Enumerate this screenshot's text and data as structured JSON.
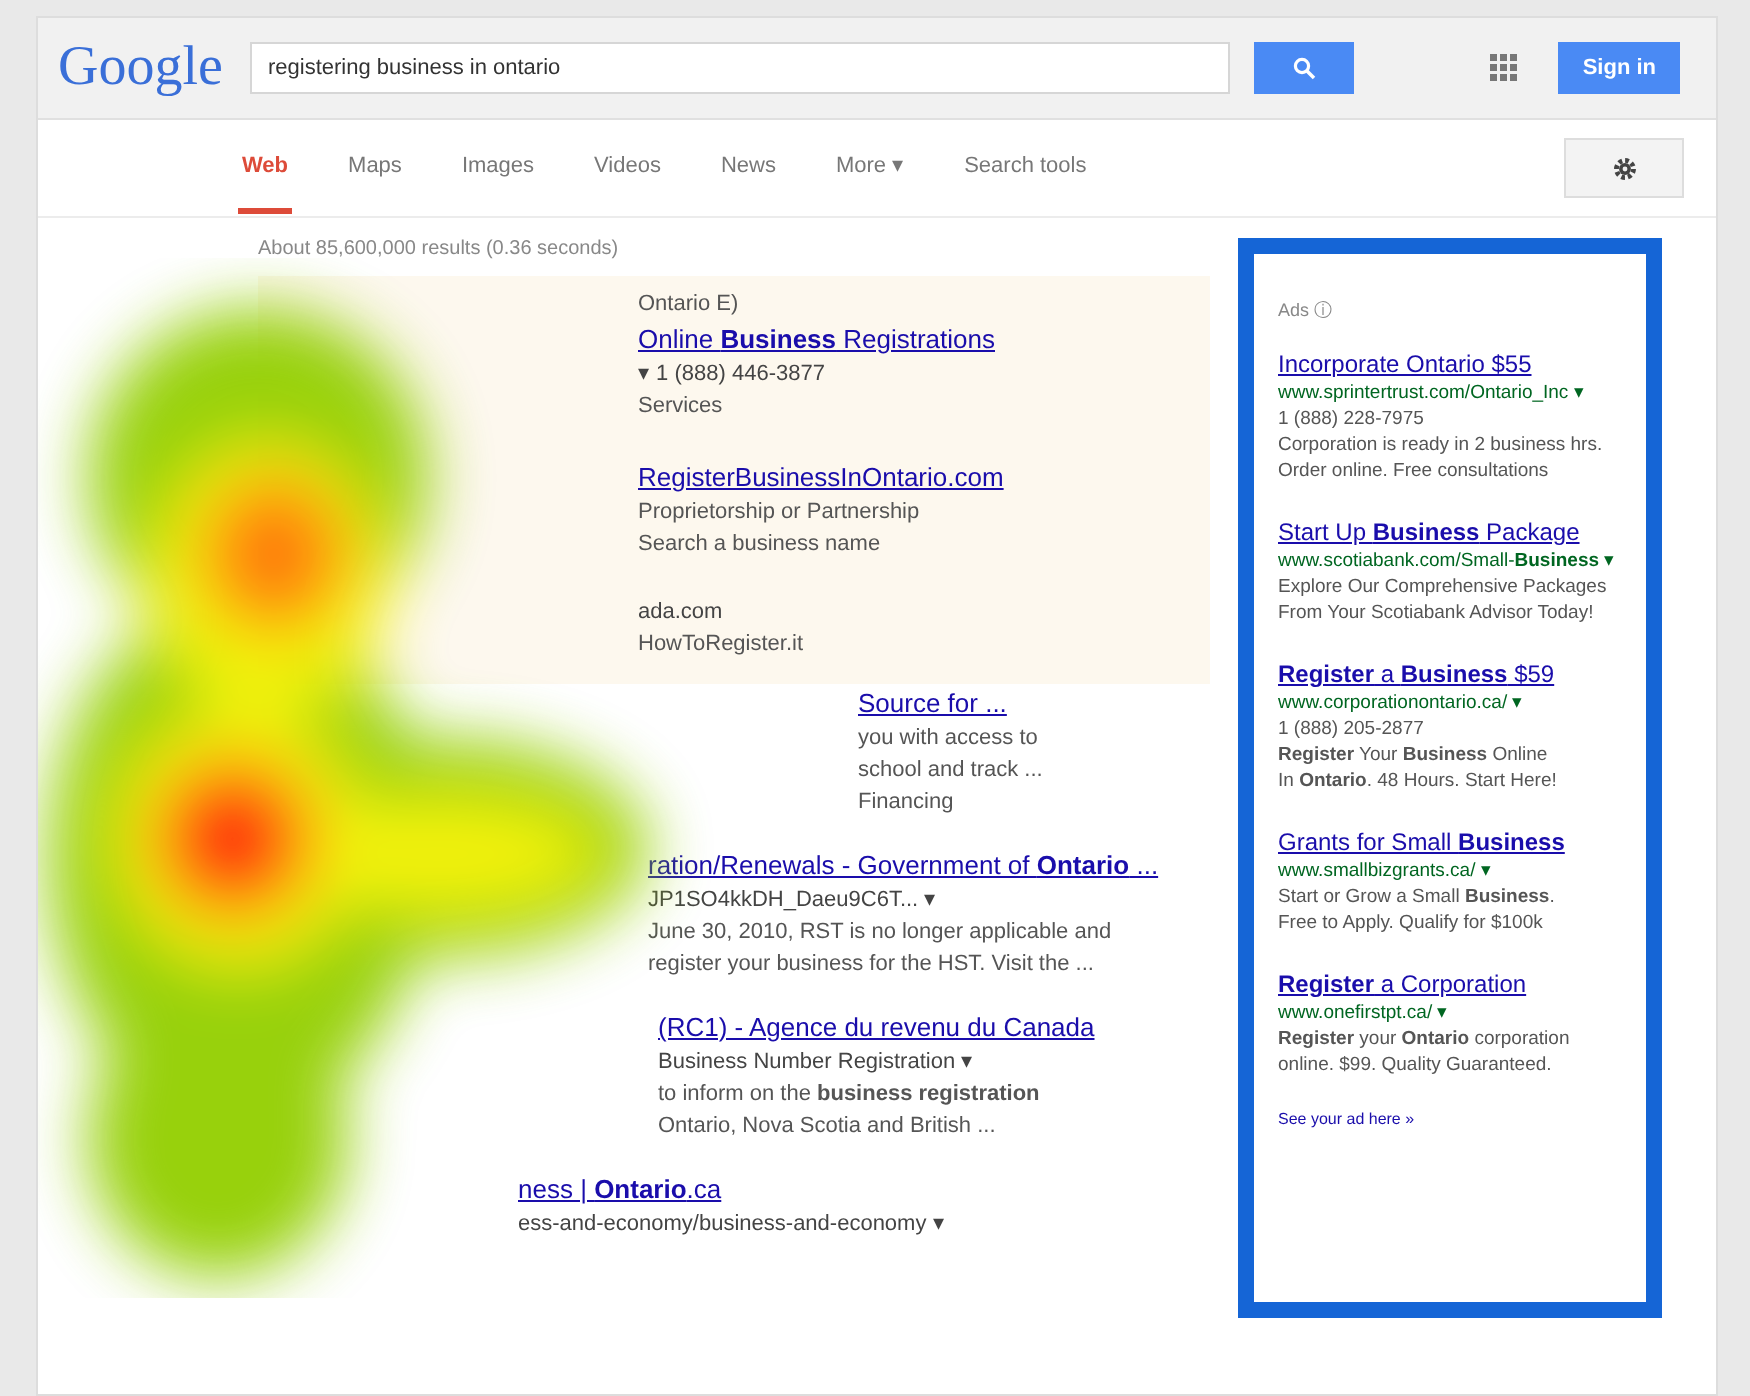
{
  "header": {
    "logo": "Google",
    "query": "registering business in ontario",
    "sign_in": "Sign in"
  },
  "tabs": [
    {
      "label": "Web",
      "selected": true
    },
    {
      "label": "Maps",
      "selected": false
    },
    {
      "label": "Images",
      "selected": false
    },
    {
      "label": "Videos",
      "selected": false
    },
    {
      "label": "News",
      "selected": false
    },
    {
      "label": "More ▾",
      "selected": false
    },
    {
      "label": "Search tools",
      "selected": false
    }
  ],
  "stats": "About 85,600,000 results (0.36 seconds)",
  "results": [
    {
      "ad": true,
      "lines": [
        {
          "kind": "text",
          "text": "Ontario E)"
        },
        {
          "kind": "title",
          "text": "Online **Business** Registrations"
        },
        {
          "kind": "url",
          "text": "▾ 1 (888) 446-3877"
        },
        {
          "kind": "text",
          "text": "Services"
        }
      ]
    },
    {
      "ad": true,
      "lines": [
        {
          "kind": "title",
          "text": "RegisterBusinessInOntario.com"
        },
        {
          "kind": "text",
          "text": "Proprietorship or Partnership"
        },
        {
          "kind": "text",
          "text": "Search a business name"
        }
      ]
    },
    {
      "ad": true,
      "lines": [
        {
          "kind": "url",
          "text": "ada.com"
        },
        {
          "kind": "text",
          "text": "HowToRegister.it"
        }
      ]
    },
    {
      "ad": false,
      "lines": [
        {
          "kind": "title",
          "text": "Source for ..."
        },
        {
          "kind": "text",
          "text": "you with access to"
        },
        {
          "kind": "text",
          "text": "school and track ..."
        },
        {
          "kind": "text",
          "text": "Financing"
        }
      ]
    },
    {
      "ad": false,
      "lines": [
        {
          "kind": "title",
          "text": "ration/Renewals - Government of **Ontario** ..."
        },
        {
          "kind": "url",
          "text": "JP1SO4kkDH_Daeu9C6T... ▾"
        },
        {
          "kind": "text",
          "text": "June 30, 2010, RST is no longer applicable and"
        },
        {
          "kind": "text",
          "text": "register your business for the HST. Visit the ..."
        }
      ]
    },
    {
      "ad": false,
      "lines": [
        {
          "kind": "title",
          "text": "(RC1) - Agence du revenu du Canada"
        },
        {
          "kind": "url",
          "text": "Business Number Registration ▾"
        },
        {
          "kind": "text",
          "text": "to inform on the **business registration**"
        },
        {
          "kind": "text",
          "text": "Ontario, Nova Scotia and British ..."
        }
      ]
    },
    {
      "ad": false,
      "lines": [
        {
          "kind": "title",
          "text": "ness | **Ontario**.ca"
        },
        {
          "kind": "url",
          "text": "ess-and-economy/business-and-economy ▾"
        }
      ]
    }
  ],
  "side_ads": {
    "label": "Ads ⓘ",
    "ads": [
      {
        "title": "Incorporate Ontario $55",
        "url": "www.sprintertrust.com/Ontario_Inc ▾",
        "lines": [
          "1 (888) 228-7975",
          "Corporation is ready in 2 business hrs.",
          "Order online. Free consultations"
        ]
      },
      {
        "title": "Start Up **Business** Package",
        "url": "www.scotiabank.com/Small-**Business** ▾",
        "lines": [
          "Explore Our Comprehensive Packages",
          "From Your Scotiabank Advisor Today!"
        ]
      },
      {
        "title": "**Register** a **Business** $59",
        "url": "www.corporationontario.ca/ ▾",
        "lines": [
          "1 (888) 205-2877",
          "**Register** Your **Business** Online",
          "In **Ontario**. 48 Hours. Start Here!"
        ]
      },
      {
        "title": "Grants for Small **Business**",
        "url": "www.smallbizgrants.ca/ ▾",
        "lines": [
          "Start or Grow a Small **Business**.",
          "Free to Apply. Qualify for $100k"
        ]
      },
      {
        "title": "**Register** a Corporation",
        "url": "www.onefirstpt.ca/ ▾",
        "lines": [
          "**Register** your **Ontario** corporation",
          "online. $99. Quality Guaranteed."
        ]
      }
    ],
    "more": "See your ad here »"
  }
}
